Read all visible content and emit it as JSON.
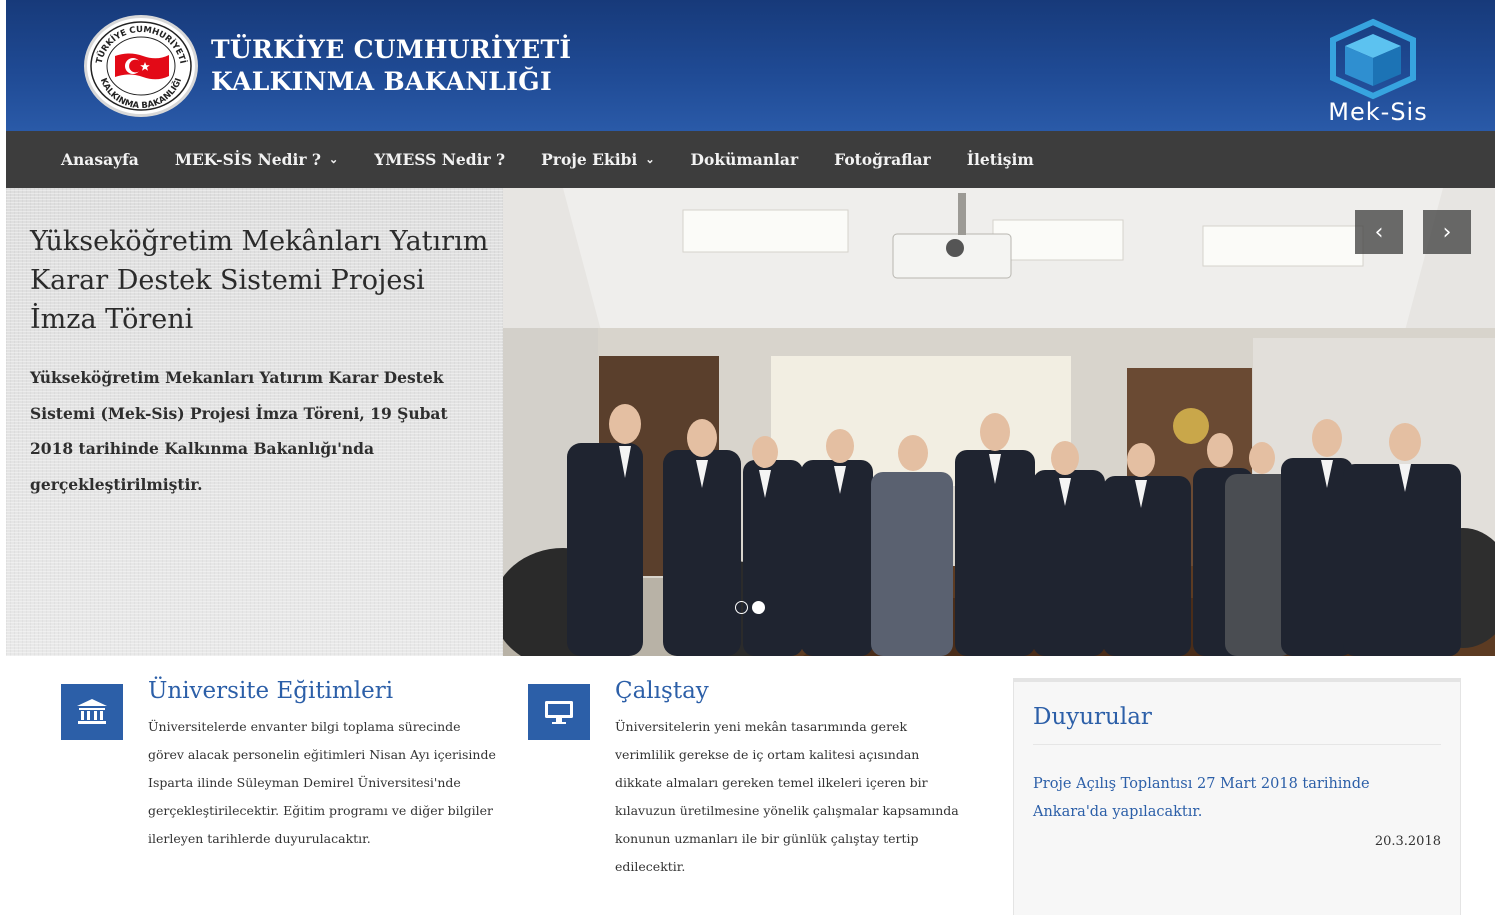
{
  "header": {
    "title_line1": "TÜRKİYE CUMHURİYETİ",
    "title_line2": "KALKINMA BAKANLIĞI",
    "seal_text_top": "TÜRKİYE CUMHURİYETİ",
    "seal_text_bottom": "KALKINMA BAKANLIĞI",
    "logo_text": "Mek-Sis",
    "seal_icon": "crescent-star-flag-icon",
    "logo_icon": "hexagon-cube-icon"
  },
  "nav": {
    "items": [
      {
        "label": "Anasayfa",
        "dropdown": false
      },
      {
        "label": "MEK-SİS Nedir ?",
        "dropdown": true
      },
      {
        "label": "YMESS Nedir ?",
        "dropdown": false
      },
      {
        "label": "Proje Ekibi",
        "dropdown": true
      },
      {
        "label": "Dokümanlar",
        "dropdown": false
      },
      {
        "label": "Fotoğraflar",
        "dropdown": false
      },
      {
        "label": "İletişim",
        "dropdown": false
      }
    ],
    "chevron": "⌄"
  },
  "hero": {
    "title": "Yükseköğretim Mekânları Yatırım Karar Destek Sistemi Projesi İmza Töreni",
    "text": "Yükseköğretim Mekanları Yatırım Karar Destek Sistemi (Mek-Sis) Projesi İmza Töreni, 19 Şubat 2018 tarihinde Kalkınma Bakanlığı'nda gerçekleştirilmiştir.",
    "prev_label": "‹",
    "next_label": "›",
    "slide_count": 2,
    "active_slide": 2
  },
  "features": [
    {
      "icon": "university-building-icon",
      "title": "Üniversite Eğitimleri",
      "text": "Üniversitelerde envanter bilgi toplama sürecinde görev alacak personelin eğitimleri Nisan Ayı içerisinde Isparta ilinde Süleyman Demirel Üniversitesi'nde gerçekleştirilecektir. Eğitim programı ve diğer bilgiler ilerleyen tarihlerde duyurulacaktır."
    },
    {
      "icon": "monitor-icon",
      "title": "Çalıştay",
      "text": "Üniversitelerin yeni mekân tasarımında gerek verimlilik gerekse de iç ortam kalitesi açısından dikkate almaları gereken temel ilkeleri içeren bir kılavuzun üretilmesine yönelik çalışmalar kapsamında konunun uzmanları ile bir günlük çalıştay tertip edilecektir."
    }
  ],
  "announcements": {
    "title": "Duyurular",
    "items": [
      {
        "text": "Proje Açılış Toplantısı 27 Mart 2018 tarihinde Ankara'da yapılacaktır.",
        "date": "20.3.2018"
      }
    ]
  },
  "colors": {
    "header_blue": "#1f4a94",
    "nav_bg": "#3d3d3d",
    "accent": "#2c5fa8",
    "seal_red": "#e30a17"
  }
}
